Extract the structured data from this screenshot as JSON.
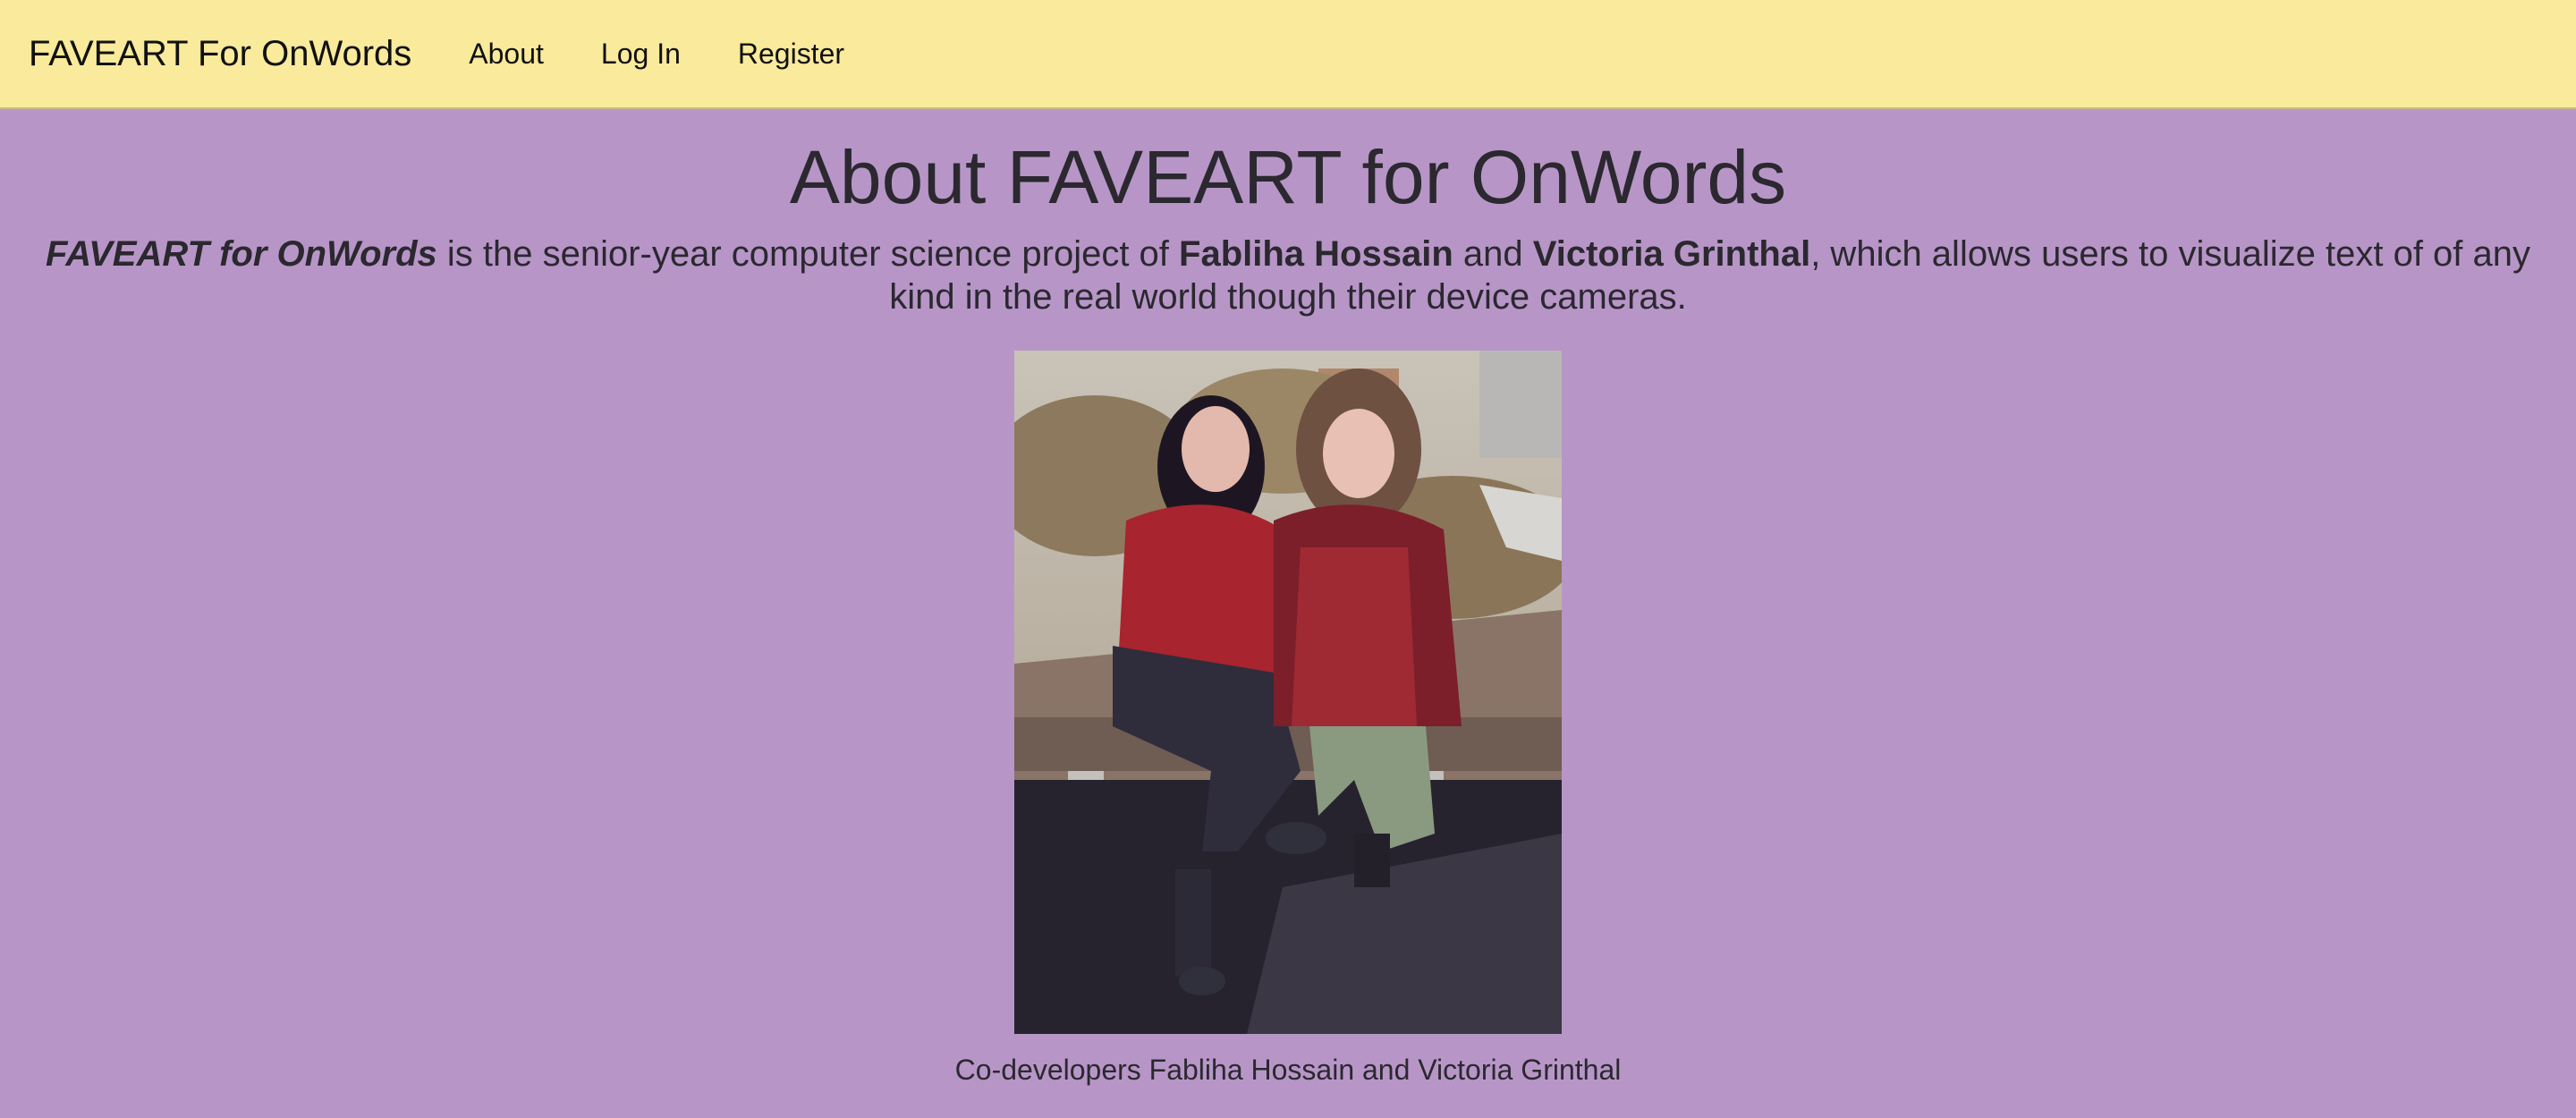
{
  "nav": {
    "brand": "FAVEART For OnWords",
    "links": [
      "About",
      "Log In",
      "Register"
    ]
  },
  "page": {
    "title": "About FAVEART for OnWords",
    "intro": {
      "project_name": "FAVEART for OnWords",
      "text_1": " is the senior-year computer science project of ",
      "person_1": "Fabliha Hossain",
      "text_2": " and ",
      "person_2": "Victoria Grinthal",
      "text_3": ", which allows users to visualize text of of any kind in the real world though their device cameras."
    },
    "caption": "Co-developers Fabliha Hossain and Victoria Grinthal"
  },
  "colors": {
    "navbar_bg": "#f9ea9c",
    "page_bg": "#b796c7",
    "text": "#2b2830"
  }
}
